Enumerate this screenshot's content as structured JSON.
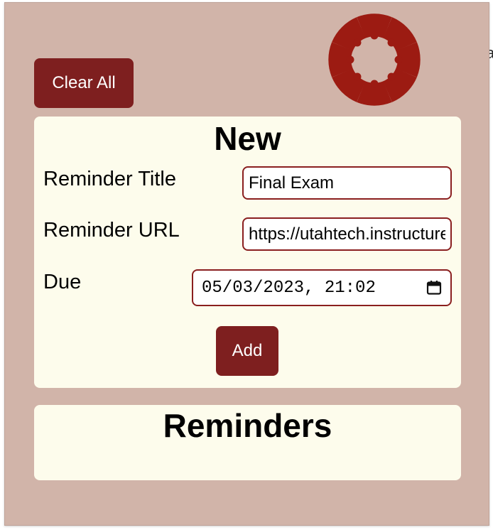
{
  "header": {
    "clear_all_label": "Clear All",
    "logo_icon": "canvas-logo-icon",
    "logo_color": "#9c1b12"
  },
  "new_reminder": {
    "heading": "New",
    "title_label": "Reminder Title",
    "title_value": "Final Exam",
    "url_label": "Reminder URL",
    "url_value": "https://utahtech.instructure.com",
    "due_label": "Due",
    "due_value": "05/03/2023, 21:02",
    "due_icon": "calendar-icon",
    "add_label": "Add"
  },
  "reminders": {
    "heading": "Reminders",
    "items": []
  },
  "background_fragment": "a",
  "colors": {
    "popup_bg": "#d1b4a9",
    "card_bg": "#fdfcec",
    "button_bg": "#7e1f1f",
    "input_border": "#8a1f1f"
  }
}
